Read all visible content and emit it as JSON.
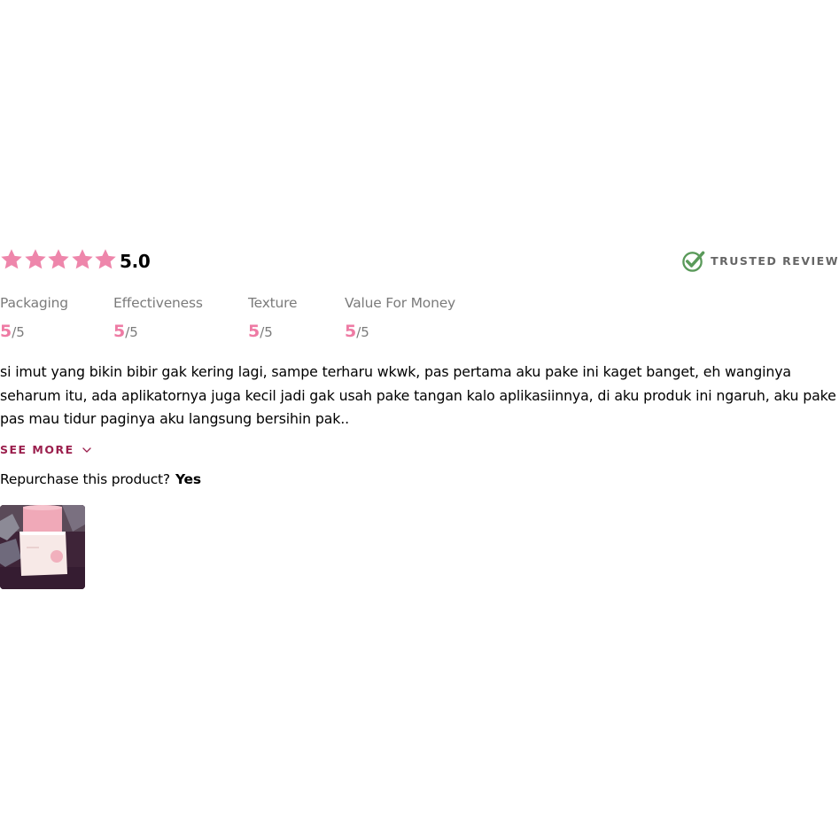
{
  "review": {
    "rating": {
      "stars_filled": 5,
      "stars_total": 5,
      "score_text": "5.0",
      "star_color": "#ee86ab"
    },
    "badge": {
      "label": "TRUSTED REVIEW",
      "icon": "check-badge-icon",
      "icon_color": "#5a9a5a"
    },
    "criteria": [
      {
        "name": "Packaging",
        "score": "5",
        "max": "/5"
      },
      {
        "name": "Effectiveness",
        "score": "5",
        "max": "/5"
      },
      {
        "name": "Texture",
        "score": "5",
        "max": "/5"
      },
      {
        "name": "Value For Money",
        "score": "5",
        "max": "/5"
      }
    ],
    "text": "si imut yang bikin bibir gak kering lagi, sampe terharu wkwk, pas pertama aku pake ini kaget banget, eh wanginya seharum itu, ada aplikatornya juga kecil jadi gak usah pake tangan kalo aplikasiinnya, di aku produk ini ngaruh, aku pake pas mau tidur paginya aku langsung bersihin pak..",
    "see_more": {
      "label": "SEE MORE",
      "icon": "chevron-down-icon",
      "color": "#9b1f4d"
    },
    "repurchase": {
      "question": "Repurchase this product?",
      "answer": "Yes"
    },
    "accent_color": "#ee7ba4"
  }
}
